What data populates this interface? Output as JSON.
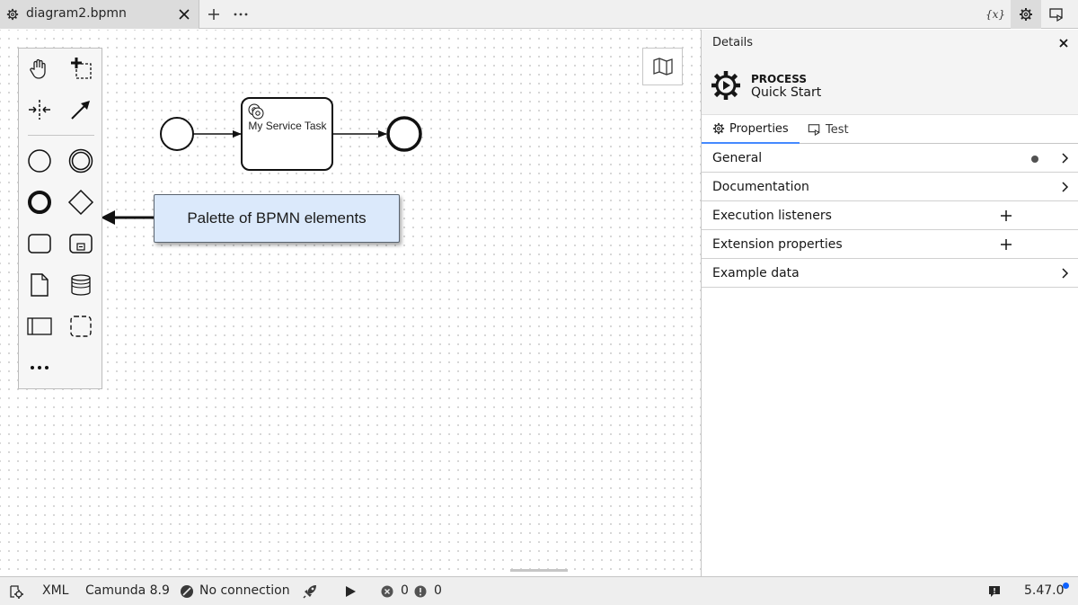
{
  "tab": {
    "filename": "diagram2.bpmn"
  },
  "toolbar": {
    "new_tab": "+",
    "more": "···",
    "variables_label": "{x}"
  },
  "canvas": {
    "callout_text": "Palette of BPMN elements",
    "service_task_label": "My Service Task",
    "palette_more": "•••"
  },
  "panel": {
    "title": "Details",
    "element_type": "PROCESS",
    "element_name": "Quick Start",
    "tabs": [
      {
        "label": "Properties",
        "active": true
      },
      {
        "label": "Test",
        "active": false
      }
    ],
    "groups": [
      {
        "label": "General",
        "indicator": true,
        "action": "expand"
      },
      {
        "label": "Documentation",
        "action": "expand"
      },
      {
        "label": "Execution listeners",
        "action": "add"
      },
      {
        "label": "Extension properties",
        "action": "add"
      },
      {
        "label": "Example data",
        "action": "expand"
      }
    ]
  },
  "statusbar": {
    "format": "XML",
    "engine": "Camunda 8.9",
    "connection": "No connection",
    "errors": "0",
    "warnings": "0",
    "version": "5.47.0"
  },
  "colors": {
    "accent": "#4589ff",
    "callout_bg": "#dbe9fb",
    "update_dot": "#0f62fe"
  }
}
